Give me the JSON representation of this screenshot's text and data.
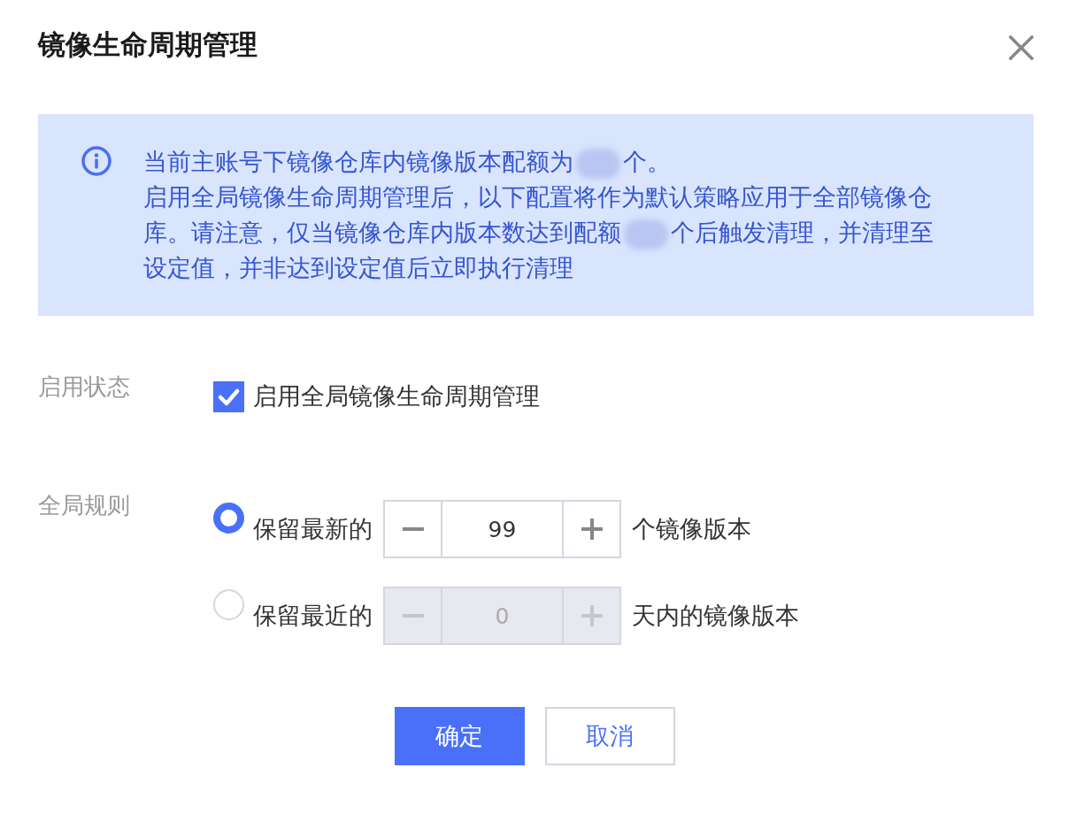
{
  "dialog": {
    "title": "镜像生命周期管理"
  },
  "notice": {
    "paragraphs": [
      {
        "before": "当前主账号下镜像仓库内镜像版本配额为",
        "redacted": true,
        "after": "个。"
      },
      {
        "before": "启用全局镜像生命周期管理后，以下配置将作为默认策略应用于全部镜像仓库。请注意，仅当镜像仓库内版本数达到配额",
        "redacted": true,
        "after": "个后触发清理，并清理至设定值，并非达到设定值后立即执行清理"
      }
    ]
  },
  "status": {
    "label": "启用状态",
    "option": {
      "text": "启用全局镜像生命周期管理",
      "checked": true
    }
  },
  "rules": {
    "label": "全局规则",
    "options": [
      {
        "text": "保留最新的",
        "selected": true,
        "value": "99",
        "disabled": false,
        "unit": "个镜像版本"
      },
      {
        "text": "保留最近的",
        "selected": false,
        "value": "0",
        "disabled": true,
        "unit": "天内的镜像版本"
      }
    ]
  },
  "buttons": [
    {
      "label": "确定",
      "kind": "primary"
    },
    {
      "label": "取消",
      "kind": "secondary"
    }
  ]
}
